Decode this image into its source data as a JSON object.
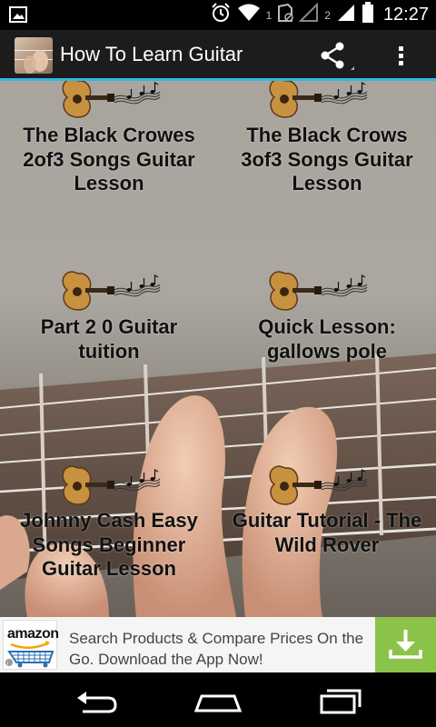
{
  "status_bar": {
    "time": "12:27",
    "sim1": "1",
    "sim2": "2",
    "icons": [
      "image-notification-icon",
      "alarm-icon",
      "wifi-icon",
      "signal-icon",
      "battery-icon"
    ]
  },
  "action_bar": {
    "title": "How To Learn Guitar",
    "accent_color": "#33b5e5",
    "icons": [
      "app-icon",
      "share-icon",
      "overflow-menu-icon"
    ]
  },
  "grid": {
    "items": [
      {
        "title": "The Black Crowes 2of3 Songs Guitar Lesson"
      },
      {
        "title": "The Black Crows 3of3 Songs Guitar Lesson"
      },
      {
        "title": "Part 2 0 Guitar tuition"
      },
      {
        "title": "Quick Lesson: gallows pole"
      },
      {
        "title": "Johnny Cash Easy Songs Beginner Guitar Lesson"
      },
      {
        "title": "Guitar Tutorial - The Wild Rover"
      }
    ]
  },
  "ad": {
    "logo_text": "amazon",
    "text": "Search Products & Compare Prices On the Go. Download the App Now!",
    "button_color": "#8bc34a"
  },
  "nav_bar": {
    "icons": [
      "back-icon",
      "home-icon",
      "recents-icon"
    ]
  }
}
